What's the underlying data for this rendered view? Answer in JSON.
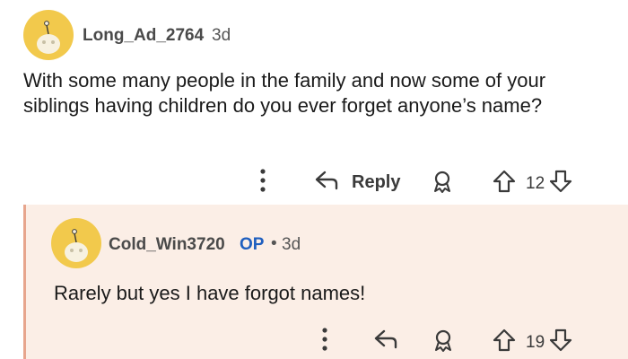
{
  "comment": {
    "username": "Long_Ad_2764",
    "age": "3d",
    "text": "With some many people in the family and now some of your siblings having children do you ever forget anyone’s name?",
    "reply_label": "Reply",
    "votes": "12"
  },
  "reply": {
    "username": "Cold_Win3720",
    "op_badge": "OP",
    "separator": "•",
    "age": "3d",
    "text": "Rarely but yes I have forgot names!",
    "votes": "19"
  },
  "colors": {
    "avatar": "#f2c94c",
    "reply_panel": "#fbeee6",
    "reply_bar": "#e7a58d",
    "op_badge": "#1f5fbf"
  },
  "icons": [
    "avatar-snoo-icon",
    "more-options-icon",
    "reply-arrow-icon",
    "award-icon",
    "upvote-icon",
    "downvote-icon"
  ]
}
